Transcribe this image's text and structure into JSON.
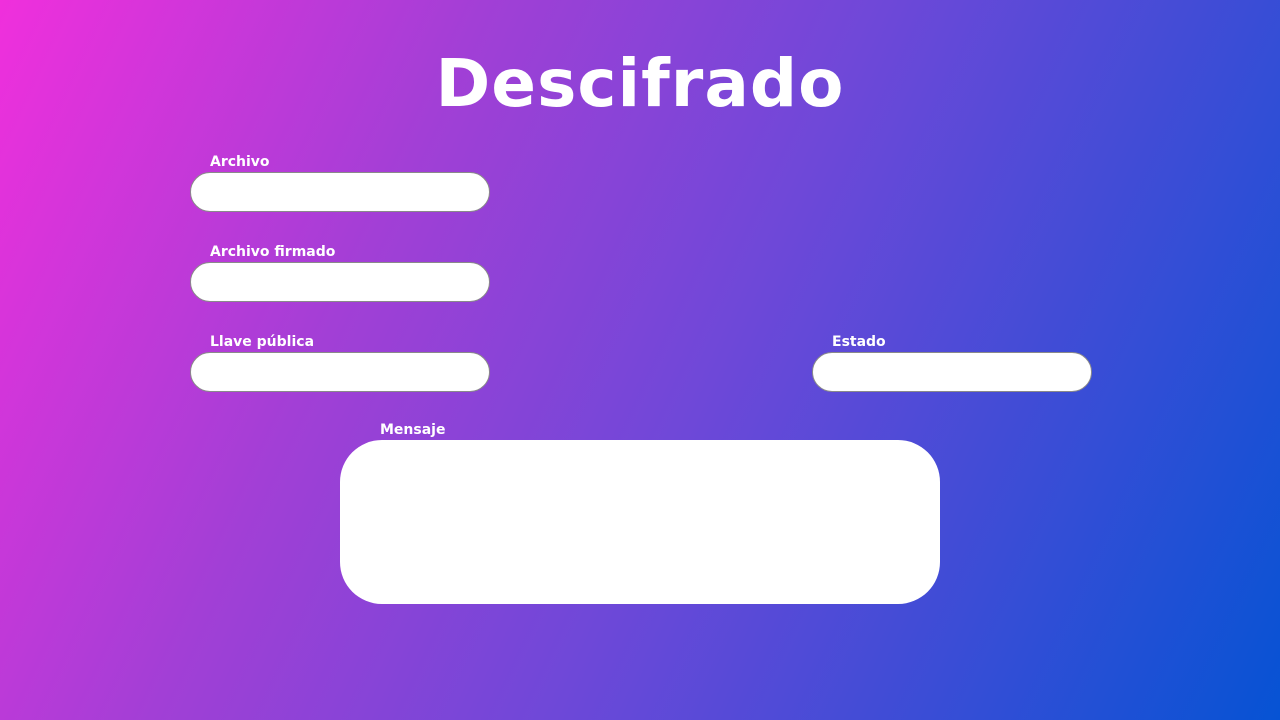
{
  "page": {
    "title": "Descifrado"
  },
  "fields": {
    "archivo": {
      "label": "Archivo",
      "value": ""
    },
    "archivo_firmado": {
      "label": "Archivo firmado",
      "value": ""
    },
    "llave_publica": {
      "label": "Llave pública",
      "value": ""
    },
    "estado": {
      "label": "Estado",
      "value": ""
    },
    "mensaje": {
      "label": "Mensaje",
      "value": ""
    }
  },
  "colors": {
    "gradient_start": "#f02fdc",
    "gradient_end": "#0653d4",
    "text": "#ffffff",
    "field_background": "#ffffff"
  }
}
